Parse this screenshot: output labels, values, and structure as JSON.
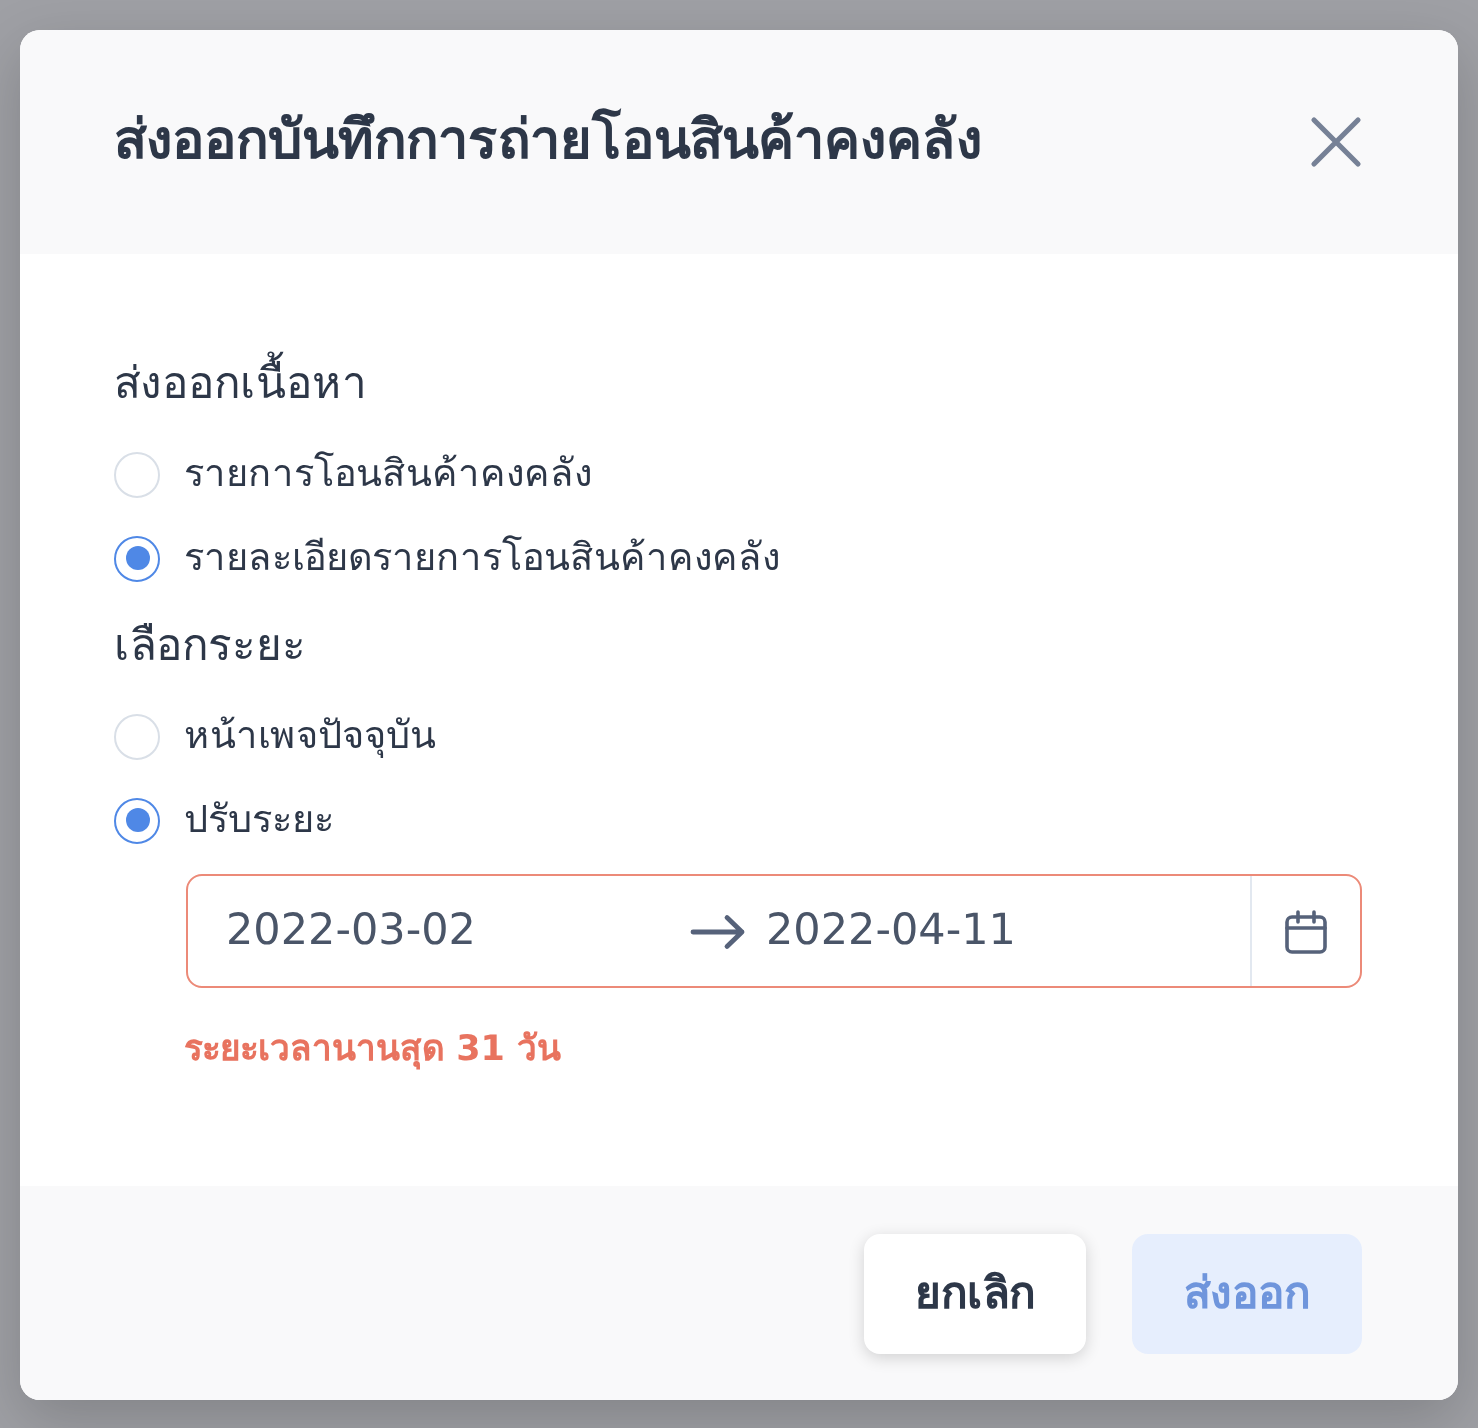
{
  "dialog": {
    "title": "ส่งออกบันทึกการถ่ายโอนสินค้าคงคลัง"
  },
  "sections": [
    {
      "label": "ส่งออกเนื้อหา",
      "options": [
        {
          "label": "รายการโอนสินค้าคงคลัง",
          "selected": false
        },
        {
          "label": "รายละเอียดรายการโอนสินค้าคงคลัง",
          "selected": true
        }
      ]
    },
    {
      "label": "เลือกระยะ",
      "options": [
        {
          "label": "หน้าเพจปัจจุบัน",
          "selected": false
        },
        {
          "label": "ปรับระยะ",
          "selected": true
        }
      ],
      "date_range": {
        "start": "2022-03-02",
        "end": "2022-04-11",
        "invalid": true
      },
      "error": "ระยะเวลานานสุด 31 วัน"
    }
  ],
  "buttons": [
    {
      "label": "ยกเลิก",
      "kind": "secondary",
      "disabled": false
    },
    {
      "label": "ส่งออก",
      "kind": "primary",
      "disabled": true
    }
  ]
}
